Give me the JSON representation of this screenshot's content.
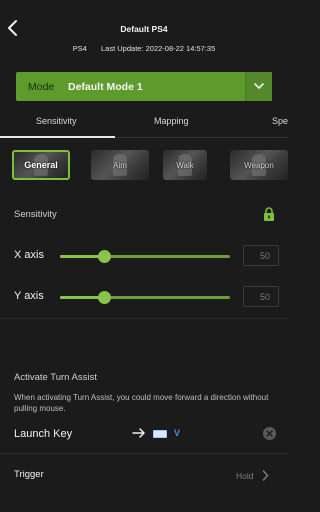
{
  "header": {
    "title": "Default PS4",
    "device": "PS4",
    "last_update": "Last Update: 2022-08-22 14:57:35"
  },
  "mode": {
    "label": "Mode",
    "value": "Default Mode 1"
  },
  "tabs": [
    {
      "label": "Sensitivity",
      "active": true
    },
    {
      "label": "Mapping",
      "active": false
    },
    {
      "label": "Spe",
      "active": false
    }
  ],
  "characters": [
    {
      "label": "General",
      "active": true
    },
    {
      "label": "Aim",
      "active": false
    },
    {
      "label": "Walk",
      "active": false
    },
    {
      "label": "Weapon",
      "active": false
    }
  ],
  "sensitivity": {
    "section_label": "Sensitivity",
    "x_axis": {
      "label": "X axis",
      "value": "50",
      "level": 0.5
    },
    "y_axis": {
      "label": "Y axis",
      "value": "50",
      "level": 0.5
    }
  },
  "turn_assist": {
    "title": "Activate Turn Assist",
    "description": "When activating Turn Assist, you could move forward a direction without pulling mouse.",
    "launch_key_label": "Launch Key",
    "launch_key_value": "V"
  },
  "trigger": {
    "label": "Trigger",
    "value": "Hold"
  },
  "colors": {
    "accent": "#7cc03a",
    "mode_bar": "#5f9a2c",
    "key_blue": "#4a90e2",
    "background": "#1b1b1b"
  }
}
